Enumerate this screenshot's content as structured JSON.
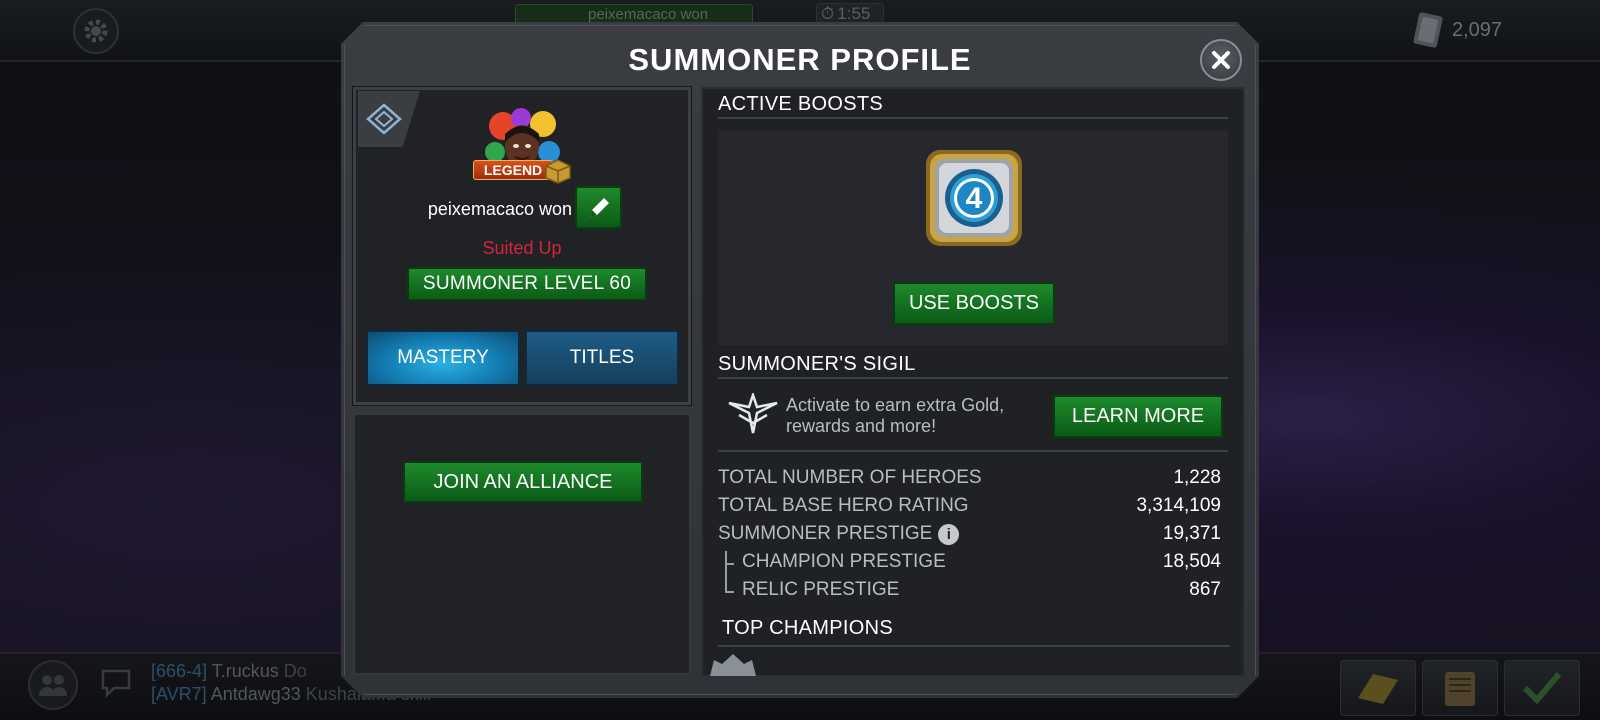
{
  "background": {
    "top_center_text": "peixemacaco won",
    "timer": "1:55",
    "units": "2,097",
    "chat": [
      {
        "tag": "[666-4]",
        "name": "T.ruckus",
        "message": "Do"
      },
      {
        "tag": "[AVR7]",
        "name": "Antdawg33",
        "message": "Kushala...a skill"
      }
    ]
  },
  "modal": {
    "title": "SUMMONER PROFILE"
  },
  "profile": {
    "badge": "LEGEND",
    "username": "peixemacaco won",
    "status": "Suited Up",
    "level_label": "SUMMONER LEVEL 60",
    "tabs": [
      {
        "label": "MASTERY",
        "active": true
      },
      {
        "label": "TITLES",
        "active": false
      }
    ],
    "alliance_button": "JOIN AN ALLIANCE"
  },
  "boosts": {
    "header": "ACTIVE BOOSTS",
    "button": "USE BOOSTS",
    "boost_icon": "fantastic-four-boost-icon"
  },
  "sigil": {
    "header": "SUMMONER'S SIGIL",
    "description": "Activate to earn extra Gold, rewards and more!",
    "button": "LEARN MORE"
  },
  "stats": [
    {
      "label": "TOTAL NUMBER OF HEROES",
      "value": "1,228"
    },
    {
      "label": "TOTAL BASE HERO RATING",
      "value": "3,314,109"
    },
    {
      "label": "SUMMONER PRESTIGE",
      "value": "19,371"
    },
    {
      "label": "CHAMPION PRESTIGE",
      "value": "18,504"
    },
    {
      "label": "RELIC PRESTIGE",
      "value": "867"
    }
  ],
  "top_champions_header": "TOP CHAMPIONS",
  "colors": {
    "green_button": "#1e8a2c",
    "blue_tab_active": "#2bb2e6",
    "status_red": "#d6243a",
    "panel_bg": "#202226"
  }
}
